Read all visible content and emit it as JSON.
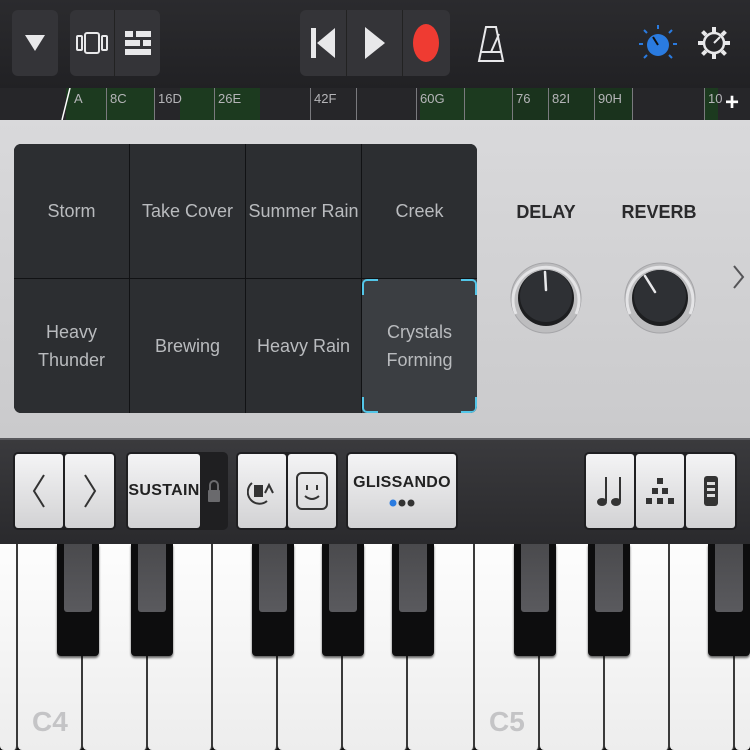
{
  "toolbar": {
    "tracks_icon": "triangle-down-icon",
    "browser_icon": "track-view-icon",
    "mixer_icon": "smart-controls-icon",
    "rewind_icon": "rewind-to-start-icon",
    "play_icon": "play-icon",
    "record_icon": "record-icon",
    "metronome_icon": "metronome-icon",
    "master_icon": "master-knob-icon",
    "settings_icon": "gear-icon",
    "colors": {
      "record": "#ef3b32",
      "accent": "#2a7be0"
    }
  },
  "ruler": {
    "labels": [
      "A",
      "8C",
      "16D",
      "26E",
      "42F",
      "60G",
      "76",
      "82I",
      "90H",
      "10"
    ]
  },
  "pads": [
    {
      "label": "Storm"
    },
    {
      "label": "Take Cover"
    },
    {
      "label": "Summer Rain"
    },
    {
      "label": "Creek"
    },
    {
      "label": "Heavy Thunder"
    },
    {
      "label": "Brewing"
    },
    {
      "label": "Heavy Rain"
    },
    {
      "label": "Crystals Forming",
      "selected": true
    }
  ],
  "knobs": {
    "delay": {
      "label": "DELAY"
    },
    "reverb": {
      "label": "REVERB"
    }
  },
  "controls": {
    "octave_down_icon": "chevron-left-icon",
    "octave_up_icon": "chevron-right-icon",
    "sustain_label": "SUSTAIN",
    "sustain_lock_icon": "lock-icon",
    "arpeggiator_icon": "arpeggiator-icon",
    "keyboard_scale_icon": "face-icon",
    "glissando_label": "GLISSANDO",
    "glissando_dots_icon": "three-dots-icon",
    "notes_icon": "notes-icon",
    "chords_icon": "chord-dots-icon",
    "velocity_icon": "velocity-slider-icon"
  },
  "keyboard": {
    "labels": {
      "c4": "C4",
      "c5": "C5"
    }
  }
}
